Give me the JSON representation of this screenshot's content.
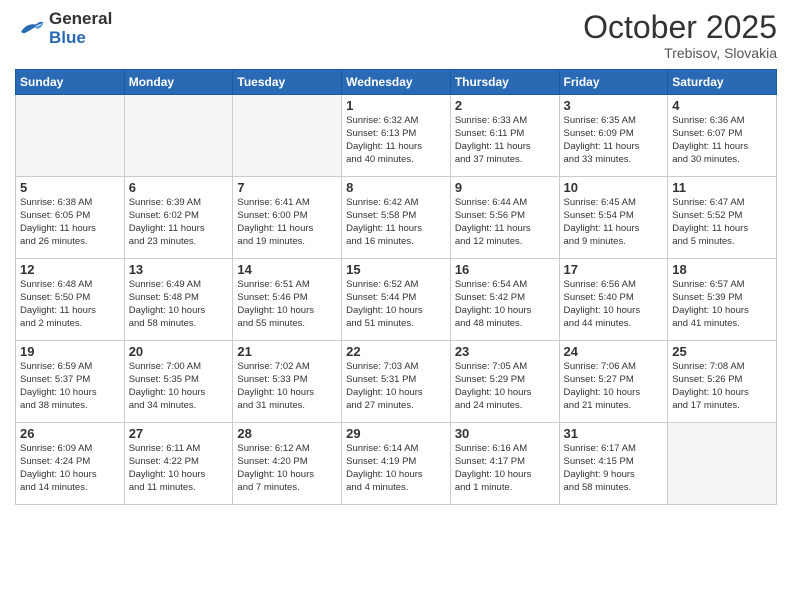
{
  "header": {
    "logo_line1": "General",
    "logo_line2": "Blue",
    "month": "October 2025",
    "location": "Trebisov, Slovakia"
  },
  "weekdays": [
    "Sunday",
    "Monday",
    "Tuesday",
    "Wednesday",
    "Thursday",
    "Friday",
    "Saturday"
  ],
  "weeks": [
    [
      {
        "day": "",
        "info": ""
      },
      {
        "day": "",
        "info": ""
      },
      {
        "day": "",
        "info": ""
      },
      {
        "day": "1",
        "info": "Sunrise: 6:32 AM\nSunset: 6:13 PM\nDaylight: 11 hours\nand 40 minutes."
      },
      {
        "day": "2",
        "info": "Sunrise: 6:33 AM\nSunset: 6:11 PM\nDaylight: 11 hours\nand 37 minutes."
      },
      {
        "day": "3",
        "info": "Sunrise: 6:35 AM\nSunset: 6:09 PM\nDaylight: 11 hours\nand 33 minutes."
      },
      {
        "day": "4",
        "info": "Sunrise: 6:36 AM\nSunset: 6:07 PM\nDaylight: 11 hours\nand 30 minutes."
      }
    ],
    [
      {
        "day": "5",
        "info": "Sunrise: 6:38 AM\nSunset: 6:05 PM\nDaylight: 11 hours\nand 26 minutes."
      },
      {
        "day": "6",
        "info": "Sunrise: 6:39 AM\nSunset: 6:02 PM\nDaylight: 11 hours\nand 23 minutes."
      },
      {
        "day": "7",
        "info": "Sunrise: 6:41 AM\nSunset: 6:00 PM\nDaylight: 11 hours\nand 19 minutes."
      },
      {
        "day": "8",
        "info": "Sunrise: 6:42 AM\nSunset: 5:58 PM\nDaylight: 11 hours\nand 16 minutes."
      },
      {
        "day": "9",
        "info": "Sunrise: 6:44 AM\nSunset: 5:56 PM\nDaylight: 11 hours\nand 12 minutes."
      },
      {
        "day": "10",
        "info": "Sunrise: 6:45 AM\nSunset: 5:54 PM\nDaylight: 11 hours\nand 9 minutes."
      },
      {
        "day": "11",
        "info": "Sunrise: 6:47 AM\nSunset: 5:52 PM\nDaylight: 11 hours\nand 5 minutes."
      }
    ],
    [
      {
        "day": "12",
        "info": "Sunrise: 6:48 AM\nSunset: 5:50 PM\nDaylight: 11 hours\nand 2 minutes."
      },
      {
        "day": "13",
        "info": "Sunrise: 6:49 AM\nSunset: 5:48 PM\nDaylight: 10 hours\nand 58 minutes."
      },
      {
        "day": "14",
        "info": "Sunrise: 6:51 AM\nSunset: 5:46 PM\nDaylight: 10 hours\nand 55 minutes."
      },
      {
        "day": "15",
        "info": "Sunrise: 6:52 AM\nSunset: 5:44 PM\nDaylight: 10 hours\nand 51 minutes."
      },
      {
        "day": "16",
        "info": "Sunrise: 6:54 AM\nSunset: 5:42 PM\nDaylight: 10 hours\nand 48 minutes."
      },
      {
        "day": "17",
        "info": "Sunrise: 6:56 AM\nSunset: 5:40 PM\nDaylight: 10 hours\nand 44 minutes."
      },
      {
        "day": "18",
        "info": "Sunrise: 6:57 AM\nSunset: 5:39 PM\nDaylight: 10 hours\nand 41 minutes."
      }
    ],
    [
      {
        "day": "19",
        "info": "Sunrise: 6:59 AM\nSunset: 5:37 PM\nDaylight: 10 hours\nand 38 minutes."
      },
      {
        "day": "20",
        "info": "Sunrise: 7:00 AM\nSunset: 5:35 PM\nDaylight: 10 hours\nand 34 minutes."
      },
      {
        "day": "21",
        "info": "Sunrise: 7:02 AM\nSunset: 5:33 PM\nDaylight: 10 hours\nand 31 minutes."
      },
      {
        "day": "22",
        "info": "Sunrise: 7:03 AM\nSunset: 5:31 PM\nDaylight: 10 hours\nand 27 minutes."
      },
      {
        "day": "23",
        "info": "Sunrise: 7:05 AM\nSunset: 5:29 PM\nDaylight: 10 hours\nand 24 minutes."
      },
      {
        "day": "24",
        "info": "Sunrise: 7:06 AM\nSunset: 5:27 PM\nDaylight: 10 hours\nand 21 minutes."
      },
      {
        "day": "25",
        "info": "Sunrise: 7:08 AM\nSunset: 5:26 PM\nDaylight: 10 hours\nand 17 minutes."
      }
    ],
    [
      {
        "day": "26",
        "info": "Sunrise: 6:09 AM\nSunset: 4:24 PM\nDaylight: 10 hours\nand 14 minutes."
      },
      {
        "day": "27",
        "info": "Sunrise: 6:11 AM\nSunset: 4:22 PM\nDaylight: 10 hours\nand 11 minutes."
      },
      {
        "day": "28",
        "info": "Sunrise: 6:12 AM\nSunset: 4:20 PM\nDaylight: 10 hours\nand 7 minutes."
      },
      {
        "day": "29",
        "info": "Sunrise: 6:14 AM\nSunset: 4:19 PM\nDaylight: 10 hours\nand 4 minutes."
      },
      {
        "day": "30",
        "info": "Sunrise: 6:16 AM\nSunset: 4:17 PM\nDaylight: 10 hours\nand 1 minute."
      },
      {
        "day": "31",
        "info": "Sunrise: 6:17 AM\nSunset: 4:15 PM\nDaylight: 9 hours\nand 58 minutes."
      },
      {
        "day": "",
        "info": ""
      }
    ]
  ]
}
